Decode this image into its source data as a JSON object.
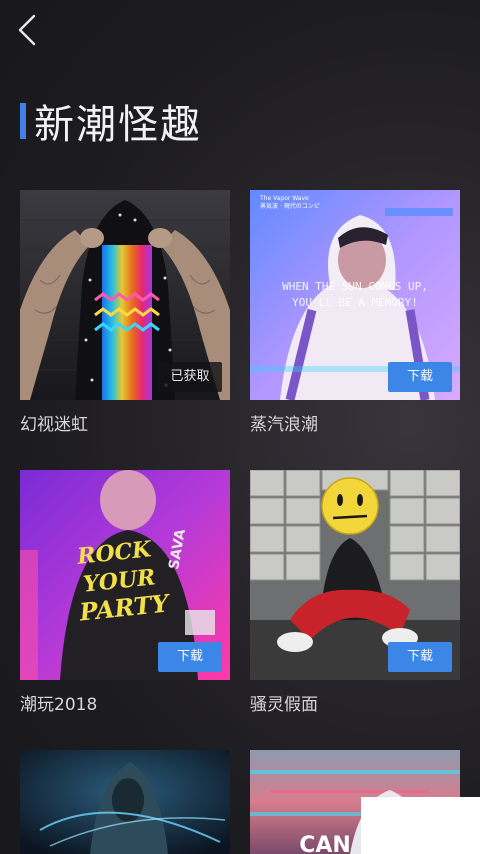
{
  "header": {
    "back_icon": "chevron-left-icon",
    "title": "新潮怪趣",
    "accent": "#3f7fe6"
  },
  "cards": [
    {
      "name": "幻视迷虹",
      "button": "已获取",
      "state": "obtained"
    },
    {
      "name": "蒸汽浪潮",
      "button": "下载",
      "state": "download",
      "art_text": {
        "top_left": "The Vapor Wave",
        "top_left_sub": "蒸気波 · 現代のコンピ",
        "line1": "WHEN THE SUN COMES UP,",
        "line2": "YOU'LL BE A MEMORY!"
      }
    },
    {
      "name": "潮玩2018",
      "button": "下载",
      "state": "download",
      "art_text": {
        "l1": "ROCK",
        "l2": "YOUR",
        "l3": "PARTY",
        "side": "SAVA"
      }
    },
    {
      "name": "骚灵假面",
      "button": "下载",
      "state": "download"
    },
    {
      "name": "",
      "button": "",
      "state": "partial"
    },
    {
      "name": "",
      "button": "",
      "state": "partial",
      "art_text": {
        "sign": "CAN"
      }
    }
  ],
  "colors": {
    "download_button": "#3c86e8",
    "obtained_button": "#141416",
    "label_text": "#d6d6d8"
  }
}
